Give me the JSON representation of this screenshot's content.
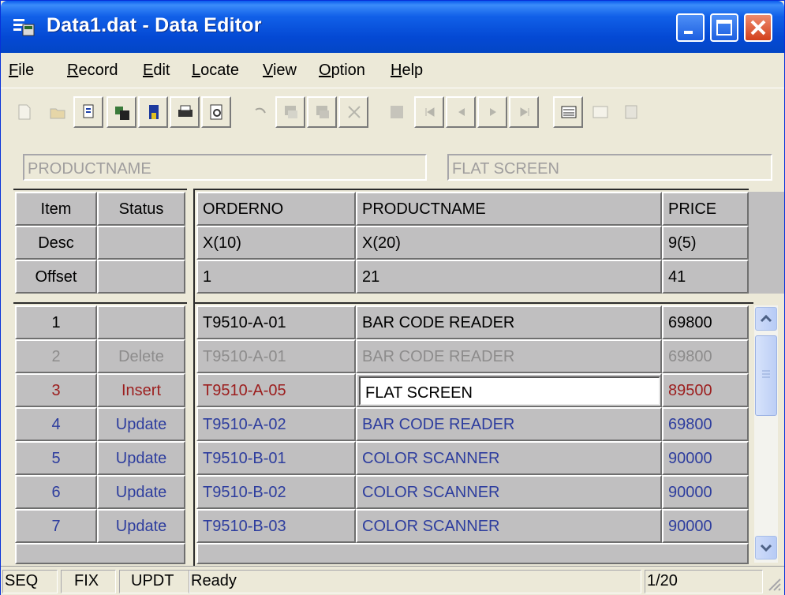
{
  "window": {
    "title": "Data1.dat - Data Editor"
  },
  "menu": [
    "File",
    "Record",
    "Edit",
    "Locate",
    "View",
    "Option",
    "Help"
  ],
  "toolbar_icons": [
    "new-record-icon",
    "open-folder-icon",
    "edit-record-icon",
    "save-floppy-icon",
    "bookmark-icon",
    "print-icon",
    "print-preview-icon",
    "undo-icon",
    "copy-record-icon",
    "paste-record-icon",
    "cut-record-icon",
    "find-icon",
    "first-record-icon",
    "prev-record-icon",
    "next-record-icon",
    "last-record-icon",
    "view-list-icon",
    "view-form-icon",
    "options-icon"
  ],
  "field_bar": {
    "field_name": "PRODUCTNAME",
    "field_value": "FLAT SCREEN"
  },
  "header_left": {
    "rows": [
      {
        "item": "Item",
        "status": "Status"
      },
      {
        "item": "Desc",
        "status": ""
      },
      {
        "item": "Offset",
        "status": ""
      }
    ]
  },
  "columns": [
    {
      "name": "ORDERNO",
      "desc": "X(10)",
      "offset": "1"
    },
    {
      "name": "PRODUCTNAME",
      "desc": "X(20)",
      "offset": "21"
    },
    {
      "name": "PRICE",
      "desc": "9(5)",
      "offset": "41"
    }
  ],
  "records": [
    {
      "num": "1",
      "status": "",
      "orderno": "T9510-A-01",
      "product": "BAR CODE READER",
      "price": "69800"
    },
    {
      "num": "2",
      "status": "Delete",
      "orderno": "T9510-A-01",
      "product": "BAR CODE READER",
      "price": "69800"
    },
    {
      "num": "3",
      "status": "Insert",
      "orderno": "T9510-A-05",
      "product": "FLAT SCREEN",
      "price": "89500"
    },
    {
      "num": "4",
      "status": "Update",
      "orderno": "T9510-A-02",
      "product": "BAR CODE READER",
      "price": "69800"
    },
    {
      "num": "5",
      "status": "Update",
      "orderno": "T9510-B-01",
      "product": "COLOR SCANNER",
      "price": "90000"
    },
    {
      "num": "6",
      "status": "Update",
      "orderno": "T9510-B-02",
      "product": "COLOR SCANNER",
      "price": "90000"
    },
    {
      "num": "7",
      "status": "Update",
      "orderno": "T9510-B-03",
      "product": "COLOR SCANNER",
      "price": "90000"
    }
  ],
  "statusbar": {
    "mode1": "SEQ",
    "mode2": "FIX",
    "mode3": "UPDT",
    "message": "Ready",
    "position": "1/20"
  },
  "colors": {
    "titlebar": "#0449d4",
    "deleted_row": "#8d8c8c",
    "inserted_row": "#9c1e1e",
    "updated_row": "#2d3d9e"
  }
}
